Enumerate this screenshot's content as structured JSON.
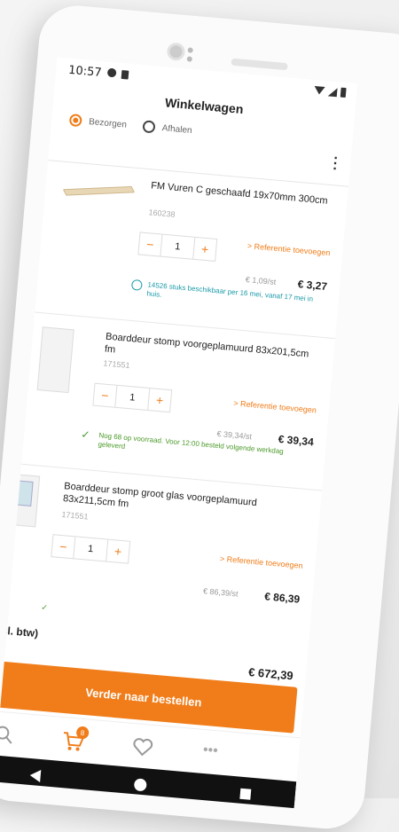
{
  "status": {
    "time": "10:57"
  },
  "header": {
    "title": "Winkelwagen",
    "options": [
      {
        "label": "Bezorgen",
        "selected": true
      },
      {
        "label": "Afhalen",
        "selected": false
      }
    ]
  },
  "items": [
    {
      "name": "FM Vuren C geschaafd 19x70mm 300cm",
      "sku": "160238",
      "qty": "1",
      "ref_link": "> Referentie toevoegen",
      "unit_price": "€ 1,09/st",
      "price": "€ 3,27",
      "stock": "14526 stuks beschikbaar per 16 mei, vanaf 17 mei in huis.",
      "stock_type": "clock-icon"
    },
    {
      "name": "Boarddeur stomp voorgeplamuurd 83x201,5cm fm",
      "sku": "171551",
      "qty": "1",
      "ref_link": "> Referentie toevoegen",
      "unit_price": "€ 39,34/st",
      "price": "€ 39,34",
      "stock": "Nog 68 op voorraad. Voor 12:00 besteld volgende werkdag geleverd",
      "stock_type": "check-icon"
    },
    {
      "name": "Boarddeur stomp groot glas voorgeplamuurd 83x211,5cm fm",
      "sku": "171551",
      "qty": "1",
      "ref_link": "> Referentie toevoegen",
      "unit_price": "€ 86,39/st",
      "price": "€ 86,39",
      "stock": "",
      "stock_type": "check-icon"
    }
  ],
  "summary": {
    "excl_label": "cl. btw)",
    "total": "€ 672,39"
  },
  "cta": {
    "label": "Verder naar bestellen"
  },
  "tabbar": {
    "cart_badge": "8",
    "tabs": [
      {
        "icon": "search-icon"
      },
      {
        "icon": "cart-icon"
      },
      {
        "icon": "heart-icon"
      },
      {
        "icon": "more-icon"
      }
    ]
  },
  "colors": {
    "accent": "#f07d1a",
    "stock_teal": "#1a9aa8",
    "stock_green": "#4c9a2a"
  }
}
